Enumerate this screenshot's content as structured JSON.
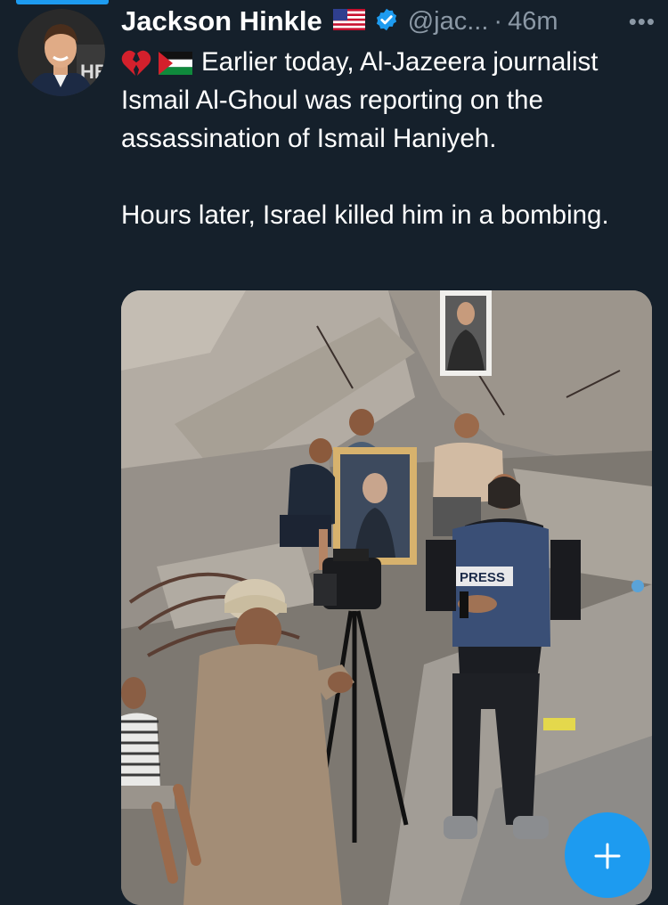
{
  "tweet": {
    "author_name": "Jackson Hinkle",
    "handle": "@jac...",
    "separator": "·",
    "time": "46m",
    "more": "•••",
    "line1": "Earlier today, Al-Jazeera journalist Ismail Al-Ghoul was reporting on the assassination of Ismail Haniyeh.",
    "line2": "Hours later, Israel killed him in a bombing."
  },
  "avatar": {
    "overlay_text": "HB"
  },
  "media": {
    "press_vest_text": "PRESS"
  },
  "icons": {
    "flag": "us-flag-icon",
    "verified": "verified-badge-icon",
    "broken_heart": "broken-heart-icon",
    "palestine_flag": "palestine-flag-icon",
    "compose": "compose-plus-icon"
  },
  "colors": {
    "background": "#15202b",
    "accent": "#1d9bf0",
    "muted": "#8b98a5",
    "text": "#ffffff"
  }
}
